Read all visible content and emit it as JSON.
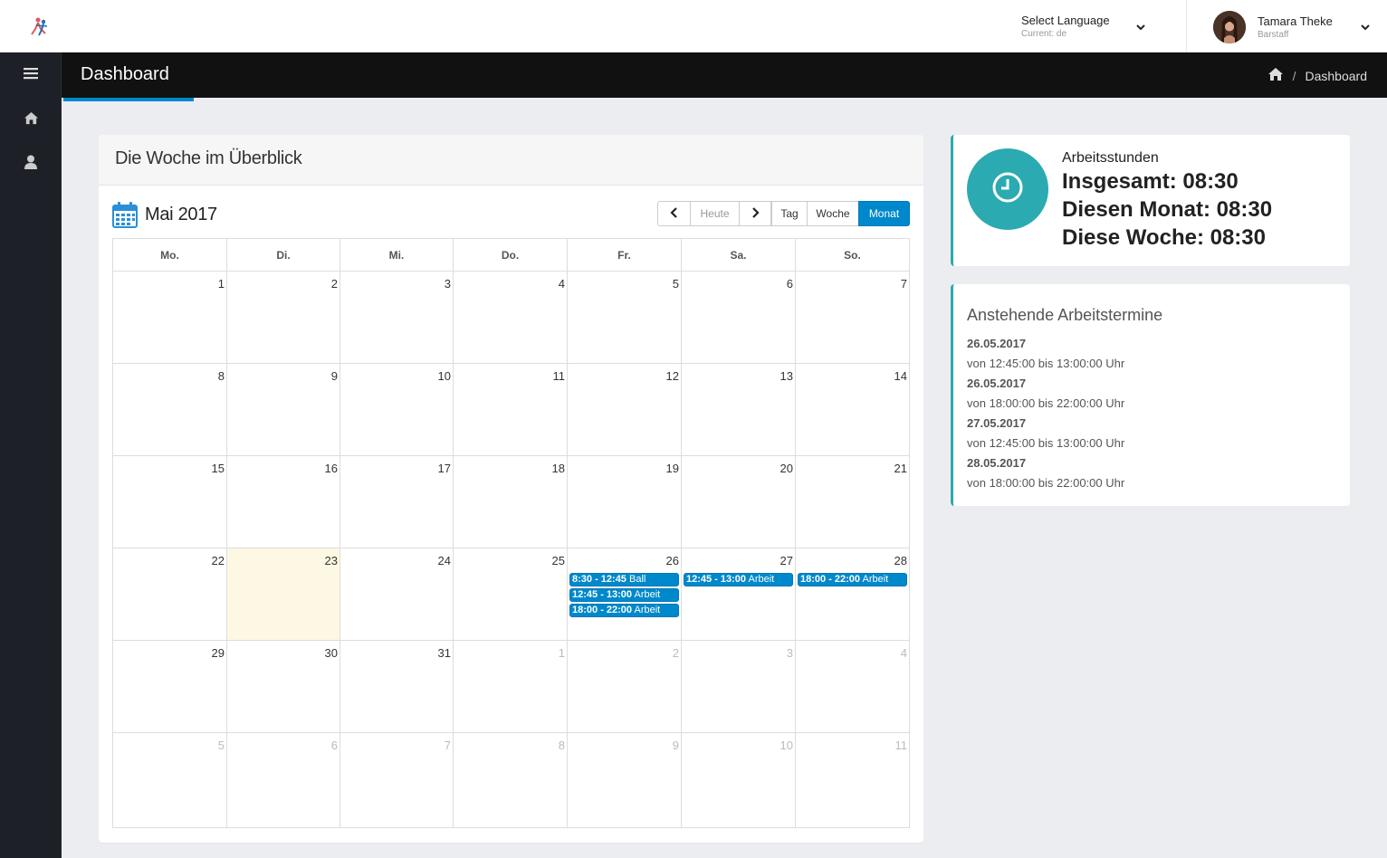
{
  "topbar": {
    "language_title": "Select Language",
    "language_current": "Current: de",
    "user_name": "Tamara Theke",
    "user_role": "Barstaff"
  },
  "header": {
    "title": "Dashboard",
    "breadcrumb_current": "Dashboard",
    "breadcrumb_separator": "/"
  },
  "sidebar": {
    "items": [
      {
        "icon": "home-icon"
      },
      {
        "icon": "user-icon"
      }
    ]
  },
  "calendar_panel": {
    "title": "Die Woche im Überblick",
    "month_label": "Mai 2017",
    "buttons": {
      "prev": "‹",
      "today": "Heute",
      "next": "›",
      "day": "Tag",
      "week": "Woche",
      "month": "Monat"
    },
    "active_view": "Monat",
    "weekdays": [
      "Mo.",
      "Di.",
      "Mi.",
      "Do.",
      "Fr.",
      "Sa.",
      "So."
    ],
    "weeks": [
      [
        {
          "d": "1"
        },
        {
          "d": "2"
        },
        {
          "d": "3"
        },
        {
          "d": "4"
        },
        {
          "d": "5"
        },
        {
          "d": "6"
        },
        {
          "d": "7"
        }
      ],
      [
        {
          "d": "8"
        },
        {
          "d": "9"
        },
        {
          "d": "10"
        },
        {
          "d": "11"
        },
        {
          "d": "12"
        },
        {
          "d": "13"
        },
        {
          "d": "14"
        }
      ],
      [
        {
          "d": "15"
        },
        {
          "d": "16"
        },
        {
          "d": "17"
        },
        {
          "d": "18"
        },
        {
          "d": "19"
        },
        {
          "d": "20"
        },
        {
          "d": "21"
        }
      ],
      [
        {
          "d": "22"
        },
        {
          "d": "23",
          "today": true
        },
        {
          "d": "24"
        },
        {
          "d": "25"
        },
        {
          "d": "26",
          "events": [
            {
              "time": "8:30 - 12:45",
              "title": "Ball"
            },
            {
              "time": "12:45 - 13:00",
              "title": "Arbeit"
            },
            {
              "time": "18:00 - 22:00",
              "title": "Arbeit"
            }
          ]
        },
        {
          "d": "27",
          "events": [
            {
              "time": "12:45 - 13:00",
              "title": "Arbeit"
            }
          ]
        },
        {
          "d": "28",
          "events": [
            {
              "time": "18:00 - 22:00",
              "title": "Arbeit"
            }
          ]
        }
      ],
      [
        {
          "d": "29"
        },
        {
          "d": "30"
        },
        {
          "d": "31"
        },
        {
          "d": "1",
          "other": true
        },
        {
          "d": "2",
          "other": true
        },
        {
          "d": "3",
          "other": true
        },
        {
          "d": "4",
          "other": true
        }
      ],
      [
        {
          "d": "5",
          "other": true
        },
        {
          "d": "6",
          "other": true
        },
        {
          "d": "7",
          "other": true
        },
        {
          "d": "8",
          "other": true
        },
        {
          "d": "9",
          "other": true
        },
        {
          "d": "10",
          "other": true
        },
        {
          "d": "11",
          "other": true
        }
      ]
    ]
  },
  "hours_panel": {
    "label": "Arbeitsstunden",
    "total": "Insgesamt: 08:30",
    "month": "Diesen Monat: 08:30",
    "week": "Diese Woche: 08:30"
  },
  "appointments_panel": {
    "title": "Anstehende Arbeitstermine",
    "items": [
      {
        "date": "26.05.2017",
        "time": "von 12:45:00 bis 13:00:00 Uhr"
      },
      {
        "date": "26.05.2017",
        "time": "von 18:00:00 bis 22:00:00 Uhr"
      },
      {
        "date": "27.05.2017",
        "time": "von 12:45:00 bis 13:00:00 Uhr"
      },
      {
        "date": "28.05.2017",
        "time": "von 18:00:00 bis 22:00:00 Uhr"
      }
    ]
  },
  "colors": {
    "accent": "#0088cc",
    "teal": "#2baab1",
    "sidebar": "#1d2127",
    "header": "#111111",
    "today": "#fcf8e3"
  }
}
